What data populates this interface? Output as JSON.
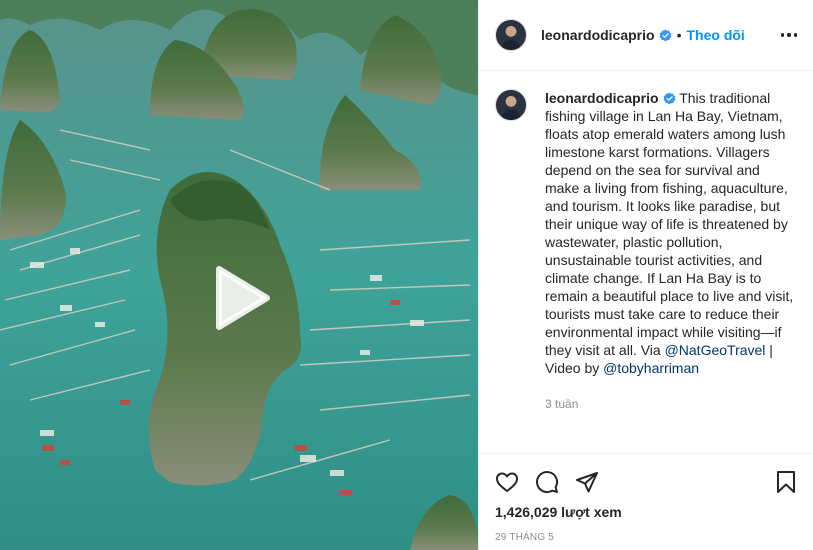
{
  "post": {
    "username": "leonardodicaprio",
    "separator": "•",
    "follow_label": "Theo dõi",
    "caption_before": "This traditional fishing village in Lan Ha Bay, Vietnam, floats atop emerald waters among lush limestone karst formations. Villagers depend on the sea for survival and make a living from fishing, aquaculture, and tourism. It looks like paradise, but their unique way of life is threatened by wastewater, plastic pollution, unsustainable tourist activities, and climate change. If Lan Ha Bay is to remain a beautiful place to live and visit, tourists must take care to reduce their environmental impact while visiting—if they visit at all. Via ",
    "mention_1": "@NatGeoTravel",
    "caption_middle": " | Video by ",
    "mention_2": "@tobyharriman",
    "relative_time": "3 tuần",
    "views": "1,426,029 lượt xem",
    "date": "29 THÁNG 5"
  },
  "icons": {
    "verified": "verified-badge-icon",
    "more": "more-options-icon",
    "like": "heart-icon",
    "comment": "comment-icon",
    "share": "paper-plane-icon",
    "save": "bookmark-icon",
    "play": "play-icon"
  },
  "colors": {
    "link_blue": "#0095f6",
    "mention": "#00376b",
    "muted": "#8e8e8e",
    "text": "#262626",
    "water": "#3e9a93"
  }
}
